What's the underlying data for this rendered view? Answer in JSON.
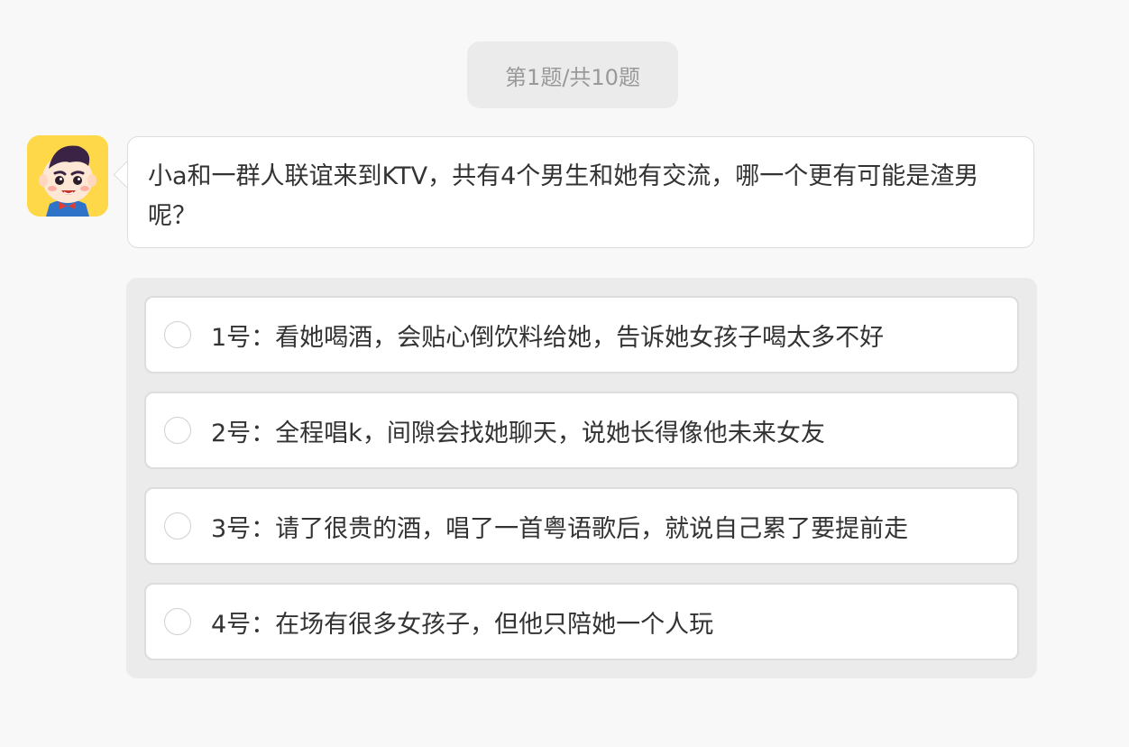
{
  "progress": {
    "label": "第1题/共10题"
  },
  "question": {
    "text": "小a和一群人联谊来到KTV，共有4个男生和她有交流，哪一个更有可能是渣男呢？",
    "avatar_icon": "cartoon-boy-avatar-icon"
  },
  "options": [
    {
      "label": "1号：看她喝酒，会贴心倒饮料给她，告诉她女孩子喝太多不好",
      "selected": false
    },
    {
      "label": "2号：全程唱k，间隙会找她聊天，说她长得像他未来女友",
      "selected": false
    },
    {
      "label": "3号：请了很贵的酒，唱了一首粤语歌后，就说自己累了要提前走",
      "selected": false
    },
    {
      "label": "4号：在场有很多女孩子，但他只陪她一个人玩",
      "selected": false
    }
  ],
  "colors": {
    "page_background": "#f8f8f8",
    "panel_background": "#ebebeb",
    "card_background": "#ffffff",
    "border": "#dddddd",
    "text": "#333333",
    "muted_text": "#999999",
    "avatar_background": "#ffd84a"
  }
}
